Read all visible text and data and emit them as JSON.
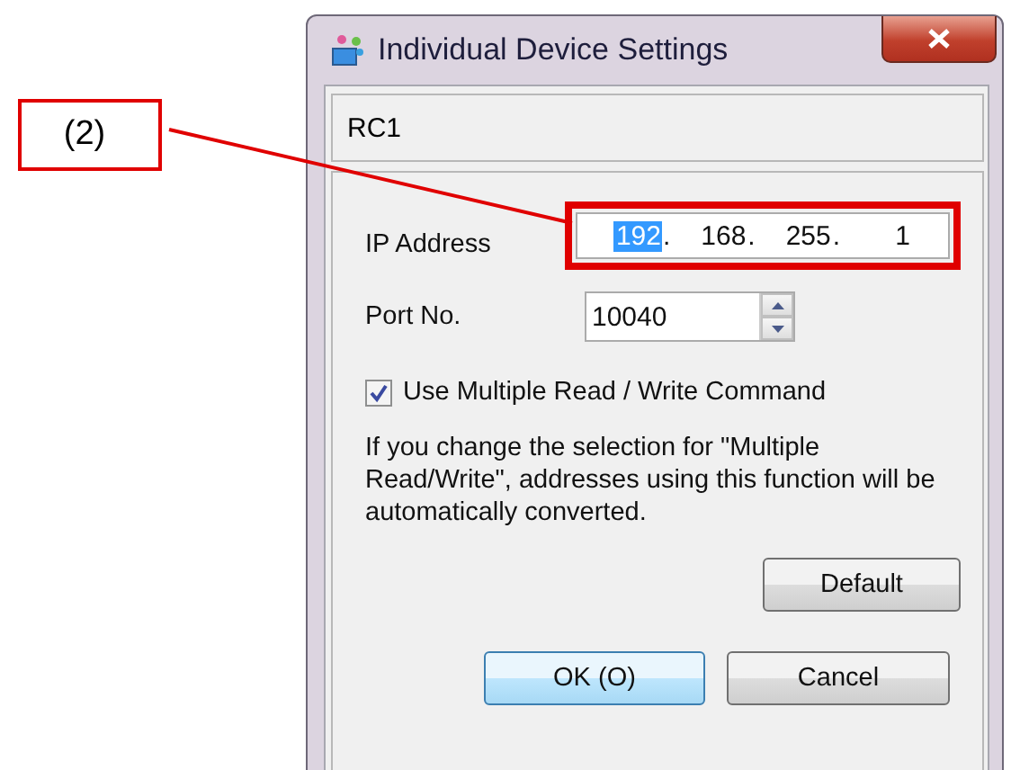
{
  "callout": {
    "label": "(2)"
  },
  "window": {
    "title": "Individual Device Settings"
  },
  "device": {
    "name": "RC1"
  },
  "ip_address": {
    "label": "IP Address",
    "octets": [
      {
        "value": "192",
        "separator": ".",
        "selected": true
      },
      {
        "value": "168",
        "separator": ".",
        "selected": false
      },
      {
        "value": "255",
        "separator": ".",
        "selected": false
      },
      {
        "value": "1",
        "selected": false
      }
    ]
  },
  "port": {
    "label": "Port No.",
    "value": "10040"
  },
  "multiple_rw": {
    "label": "Use Multiple Read / Write Command",
    "checked": true
  },
  "note": "If you change the selection for \"Multiple Read/Write\", addresses using this function will be automatically converted.",
  "buttons": [
    {
      "label": "Default",
      "kind": "secondary"
    },
    {
      "label": "OK (O)",
      "kind": "default"
    },
    {
      "label": "Cancel",
      "kind": "normal"
    }
  ]
}
